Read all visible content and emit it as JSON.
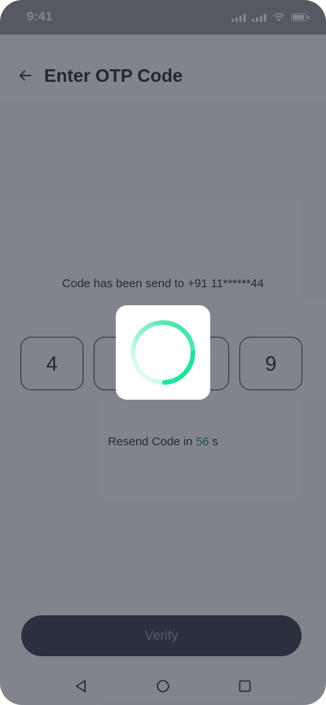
{
  "status_bar": {
    "time": "9:41"
  },
  "header": {
    "title": "Enter OTP Code"
  },
  "info": {
    "text": "Code has been send to +91 11******44"
  },
  "otp": {
    "digits": [
      "4",
      "",
      "",
      "9"
    ]
  },
  "resend": {
    "prefix": "Resend Code in ",
    "seconds": "56",
    "suffix": " s"
  },
  "actions": {
    "verify_label": "Verify"
  },
  "colors": {
    "accent": "#1f8e6b",
    "spinner": "#22e39a",
    "button": "#3d4150"
  },
  "icons": {
    "back": "arrow-left-icon",
    "nav_back": "triangle-back-icon",
    "nav_home": "circle-home-icon",
    "nav_recent": "square-recent-icon",
    "loading": "spinner-icon"
  }
}
